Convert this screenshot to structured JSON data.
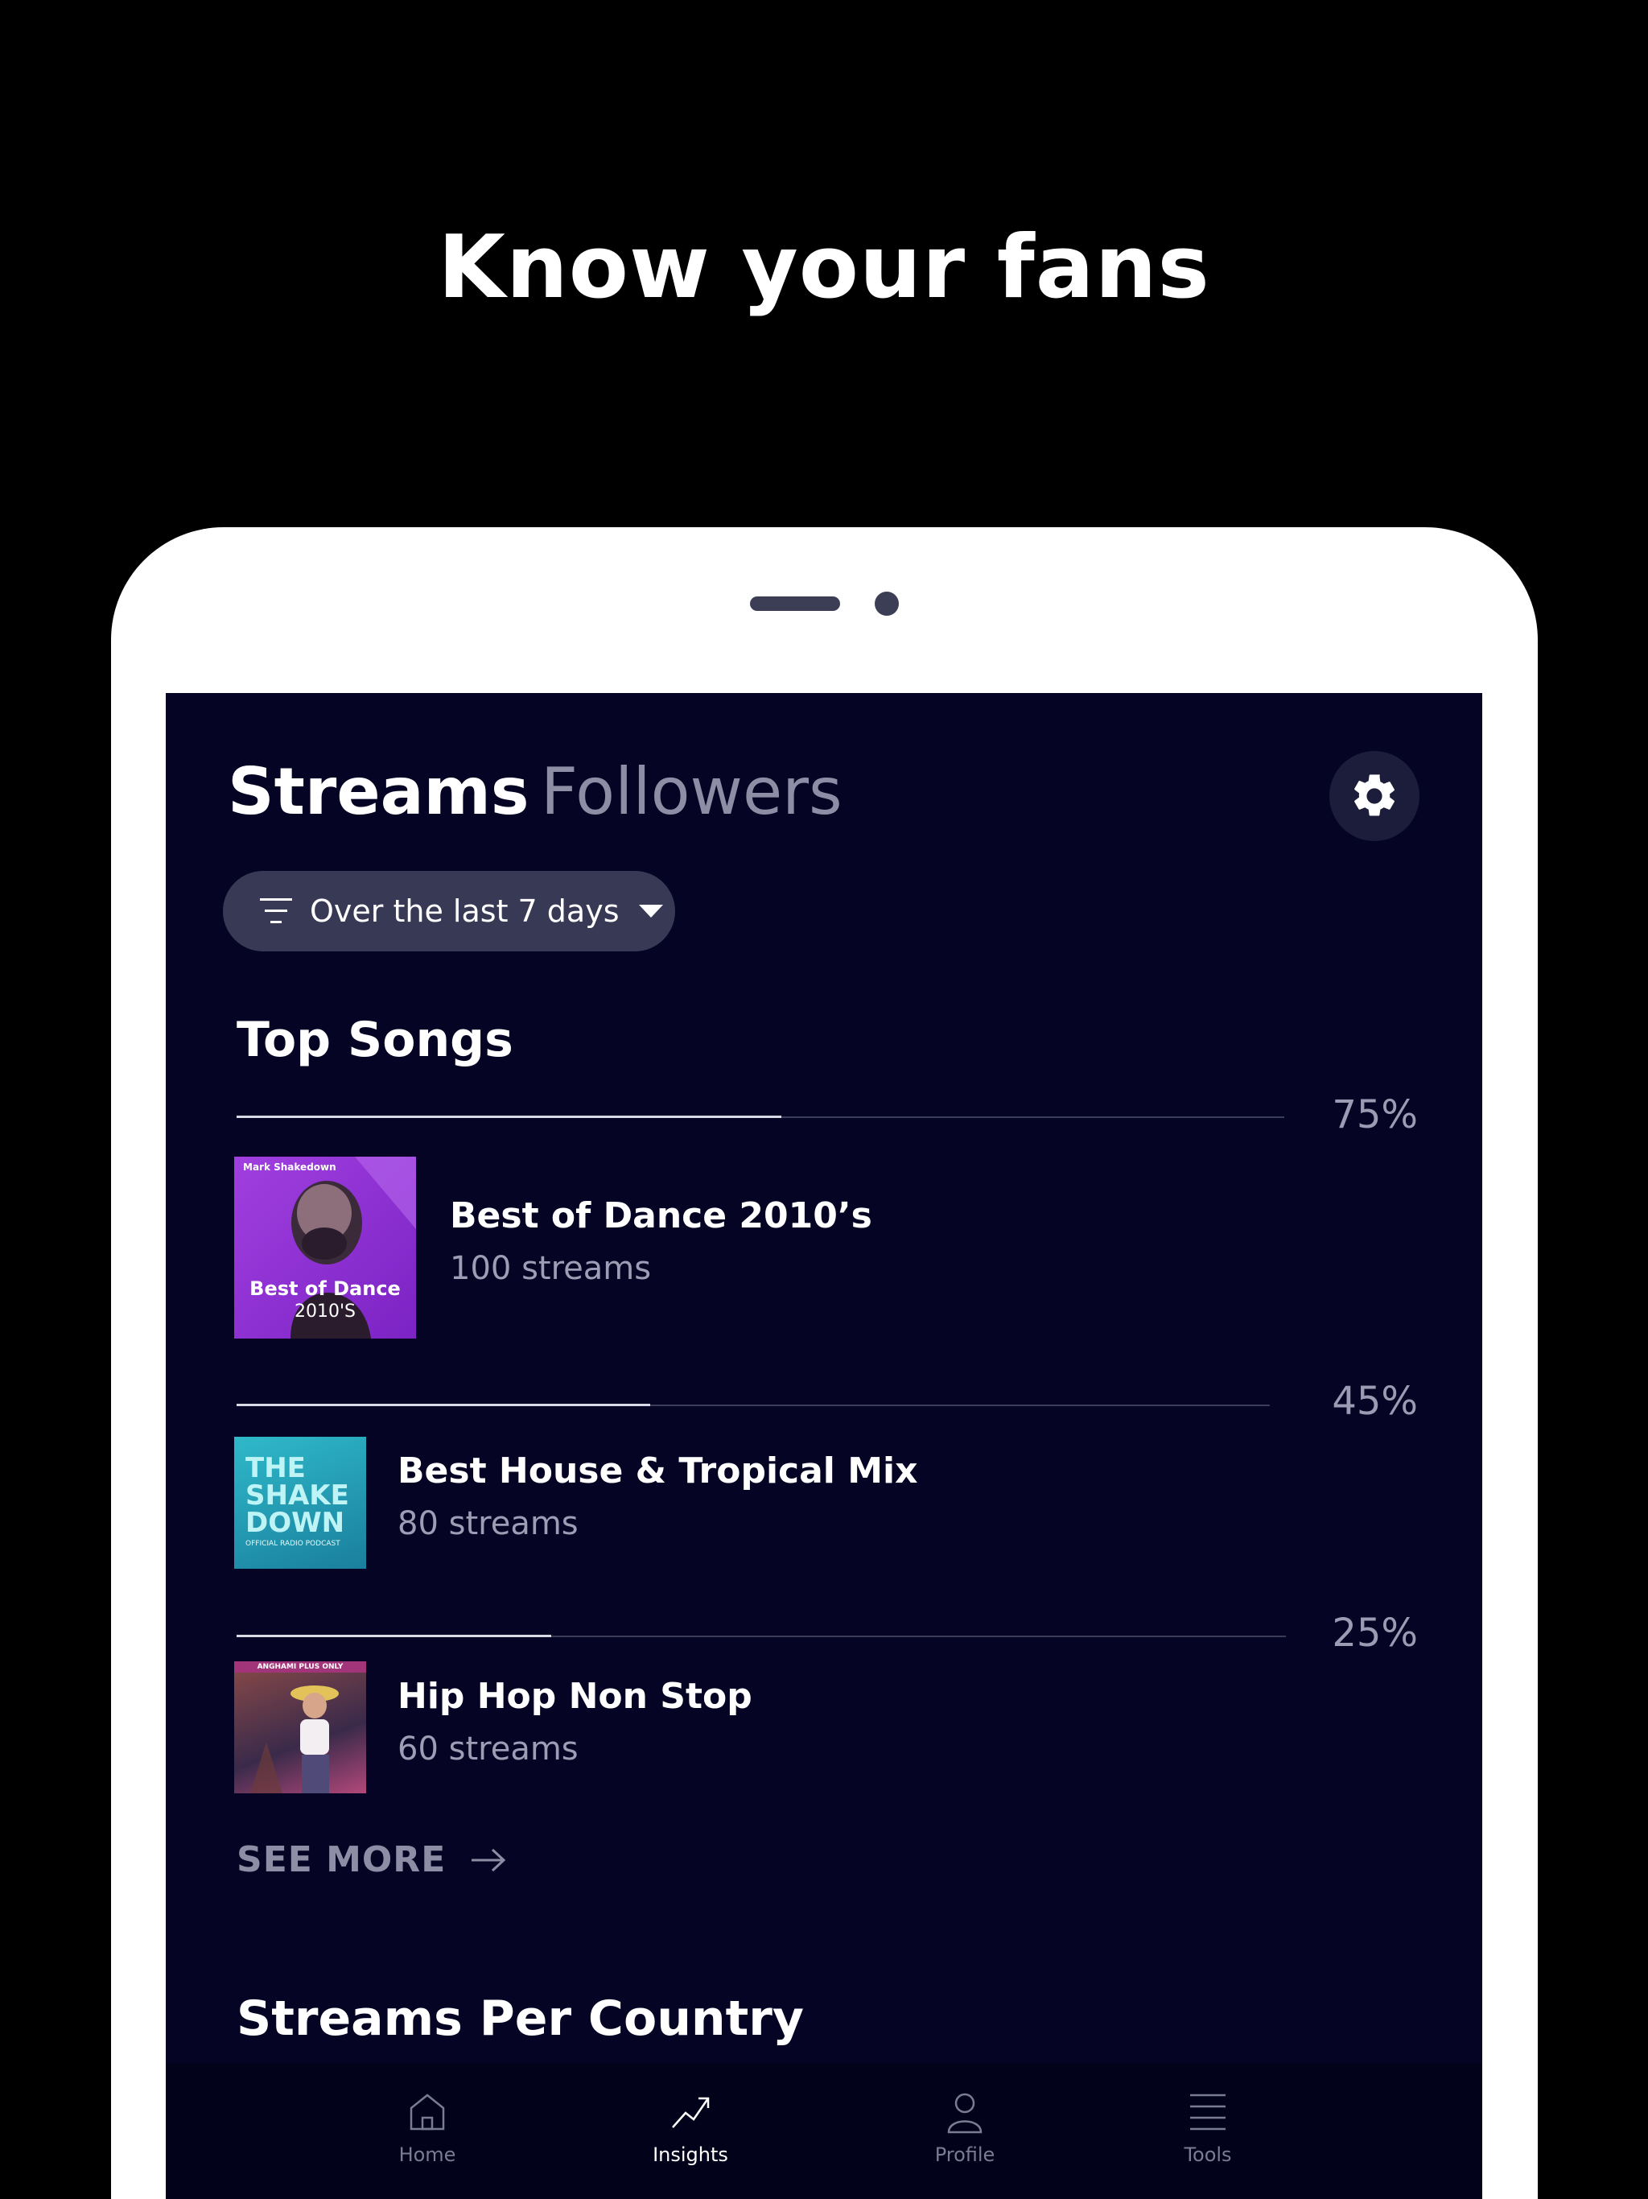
{
  "headline": "Know your fans",
  "tabs": {
    "streams": "Streams",
    "followers": "Followers"
  },
  "filter": {
    "label": "Over the last 7 days"
  },
  "top_songs": {
    "title": "Top Songs",
    "songs": [
      {
        "title": "Best of Dance 2010’s",
        "streams": "100 streams",
        "percent": "75%",
        "fill": 0.52,
        "cover": {
          "artist": "Mark Shakedown",
          "line1": "Best of Dance",
          "line2": "2010'S"
        }
      },
      {
        "title": "Best House & Tropical Mix",
        "streams": "80 streams",
        "percent": "45%",
        "fill": 0.4,
        "cover": {
          "line1": "THE",
          "line2": "SHAKE",
          "line3": "DOWN",
          "line4": "OFFICIAL RADIO PODCAST"
        }
      },
      {
        "title": "Hip Hop Non Stop",
        "streams": "60 streams",
        "percent": "25%",
        "fill": 0.3,
        "cover": {
          "banner": "ANGHAMI PLUS ONLY"
        }
      }
    ],
    "see_more": "SEE MORE"
  },
  "streams_per_country": {
    "title": "Streams Per Country"
  },
  "nav": [
    {
      "label": "Home",
      "icon": "home-icon"
    },
    {
      "label": "Insights",
      "icon": "insights-icon",
      "active": true
    },
    {
      "label": "Profile",
      "icon": "profile-icon"
    },
    {
      "label": "Tools",
      "icon": "tools-icon"
    }
  ],
  "colors": {
    "screen_bg": "#050424",
    "pill_bg": "#383a55",
    "muted_text": "#8d8ea5",
    "nav_bg": "#03021b"
  }
}
